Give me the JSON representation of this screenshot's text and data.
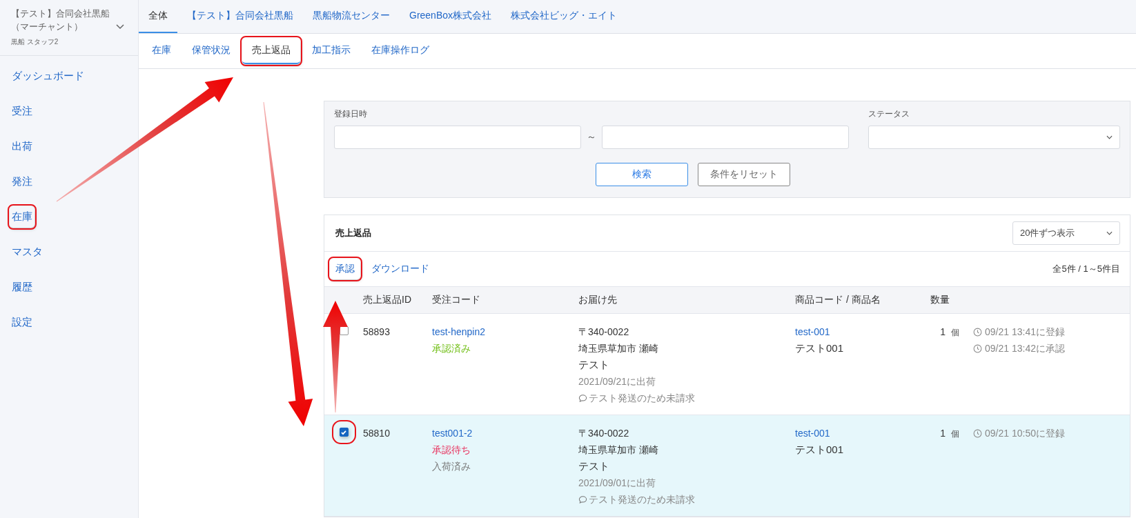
{
  "account": {
    "name": "【テスト】合同会社黒船（マーチャント）",
    "user": "黒船 スタッフ2"
  },
  "sidebar": {
    "items": [
      {
        "label": "ダッシュボード",
        "highlighted": false
      },
      {
        "label": "受注",
        "highlighted": false
      },
      {
        "label": "出荷",
        "highlighted": false
      },
      {
        "label": "発注",
        "highlighted": false
      },
      {
        "label": "在庫",
        "highlighted": true
      },
      {
        "label": "マスタ",
        "highlighted": false
      },
      {
        "label": "履歴",
        "highlighted": false
      },
      {
        "label": "設定",
        "highlighted": false
      }
    ]
  },
  "top_tabs": [
    {
      "label": "全体",
      "selected": true
    },
    {
      "label": "【テスト】合同会社黒船",
      "selected": false
    },
    {
      "label": "黒船物流センター",
      "selected": false
    },
    {
      "label": "GreenBox株式会社",
      "selected": false
    },
    {
      "label": "株式会社ビッグ・エイト",
      "selected": false
    }
  ],
  "sub_tabs": [
    {
      "label": "在庫",
      "selected": false,
      "highlighted": false
    },
    {
      "label": "保管状況",
      "selected": false,
      "highlighted": false
    },
    {
      "label": "売上返品",
      "selected": true,
      "highlighted": true
    },
    {
      "label": "加工指示",
      "selected": false,
      "highlighted": false
    },
    {
      "label": "在庫操作ログ",
      "selected": false,
      "highlighted": false
    }
  ],
  "filters": {
    "date_label": "登録日時",
    "range_separator": "～",
    "status_label": "ステータス",
    "search_button": "検索",
    "reset_button": "条件をリセット"
  },
  "table_panel": {
    "title": "売上返品",
    "page_size": "20件ずつ表示",
    "actions": [
      {
        "label": "承認",
        "highlighted": true
      },
      {
        "label": "ダウンロード",
        "highlighted": false
      }
    ],
    "count": "全5件 / 1～5件目",
    "columns": [
      "売上返品ID",
      "受注コード",
      "お届け先",
      "商品コード / 商品名",
      "数量"
    ],
    "rows": [
      {
        "checked": false,
        "checkbox_highlighted": false,
        "selected": false,
        "id": "58893",
        "order_code": "test-henpin2",
        "statuses": [
          {
            "text": "承認済み",
            "kind": "approved"
          }
        ],
        "postal": "〒340-0022",
        "address": "埼玉県草加市 瀬崎",
        "recipient": "テスト",
        "shipped": "2021/09/21に出荷",
        "note": "テスト発送のため未請求",
        "product_code": "test-001",
        "product_name": "テスト001",
        "quantity": "1",
        "unit": "個",
        "events": [
          "09/21 13:41に登録",
          "09/21 13:42に承認"
        ]
      },
      {
        "checked": true,
        "checkbox_highlighted": true,
        "selected": true,
        "id": "58810",
        "order_code": "test001-2",
        "statuses": [
          {
            "text": "承認待ち",
            "kind": "pending"
          },
          {
            "text": "入荷済み",
            "kind": "received"
          }
        ],
        "postal": "〒340-0022",
        "address": "埼玉県草加市 瀬崎",
        "recipient": "テスト",
        "shipped": "2021/09/01に出荷",
        "note": "テスト発送のため未請求",
        "product_code": "test-001",
        "product_name": "テスト001",
        "quantity": "1",
        "unit": "個",
        "events": [
          "09/21 10:50に登録"
        ]
      }
    ]
  }
}
